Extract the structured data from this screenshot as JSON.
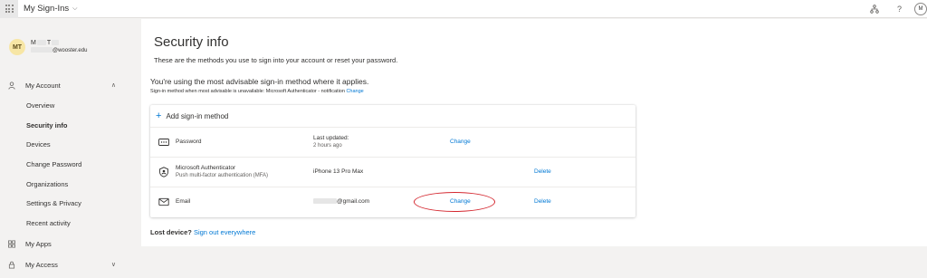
{
  "topbar": {
    "app_title": "My Sign-Ins",
    "help_symbol": "?",
    "avatar_initial": "M"
  },
  "profile": {
    "initials": "MT",
    "name_first": "M",
    "name_last": "T",
    "email_suffix": "@wooster.edu"
  },
  "nav": {
    "my_account": "My Account",
    "items": [
      "Overview",
      "Security info",
      "Devices",
      "Change Password",
      "Organizations",
      "Settings & Privacy",
      "Recent activity"
    ],
    "my_apps": "My Apps",
    "my_access": "My Access"
  },
  "main": {
    "title": "Security info",
    "subtitle": "These are the methods you use to sign into your account or reset your password.",
    "advisable": "You're using the most advisable sign-in method where it applies.",
    "advisable_note": "Sign-in method when most advisable is unavailable: Microsoft Authenticator - notification",
    "advisable_change": "Change",
    "add_method": "Add sign-in method",
    "methods": [
      {
        "name": "Password",
        "desc": "",
        "detail_top": "Last updated:",
        "detail_bottom": "2 hours ago",
        "change": "Change",
        "delete": ""
      },
      {
        "name": "Microsoft Authenticator",
        "desc": "Push multi-factor authentication (MFA)",
        "detail_top": "iPhone 13 Pro Max",
        "detail_bottom": "",
        "change": "",
        "delete": "Delete"
      },
      {
        "name": "Email",
        "desc": "",
        "detail_top": "@gmail.com",
        "detail_bottom": "",
        "change": "Change",
        "delete": "Delete"
      }
    ],
    "lost_device": "Lost device?",
    "sign_out_everywhere": "Sign out everywhere"
  },
  "colors": {
    "accent": "#0078d4",
    "highlight_circle": "#d4272f",
    "avatar_bg": "#f7e6a5"
  }
}
